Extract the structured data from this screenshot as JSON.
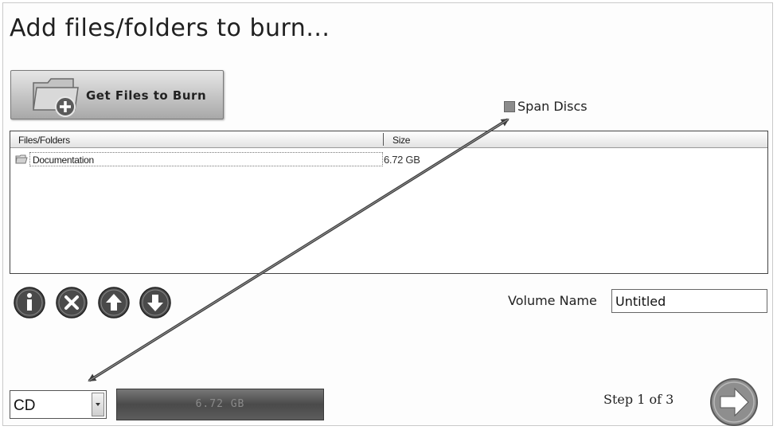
{
  "title": "Add files/folders to burn...",
  "get_files_button": {
    "label": "Get Files to Burn"
  },
  "span_discs": {
    "label": "Span Discs",
    "checked": false
  },
  "file_list": {
    "columns": [
      "Files/Folders",
      "Size"
    ],
    "rows": [
      {
        "name": "Documentation",
        "size": "6.72 GB"
      }
    ]
  },
  "actions": [
    {
      "icon": "info-icon"
    },
    {
      "icon": "remove-icon"
    },
    {
      "icon": "arrow-up-icon"
    },
    {
      "icon": "arrow-down-icon"
    }
  ],
  "volume": {
    "label": "Volume Name",
    "value": "Untitled"
  },
  "media_select": {
    "value": "CD"
  },
  "capacity_bar": {
    "text": "6.72 GB",
    "fill_fraction": 1.0
  },
  "step": {
    "text": "Step 1 of 3"
  },
  "colors": {
    "button_dark": "#4a4a4a",
    "frame_border": "#c9c9c9",
    "annotation_arrow": "#3d3d3d"
  }
}
